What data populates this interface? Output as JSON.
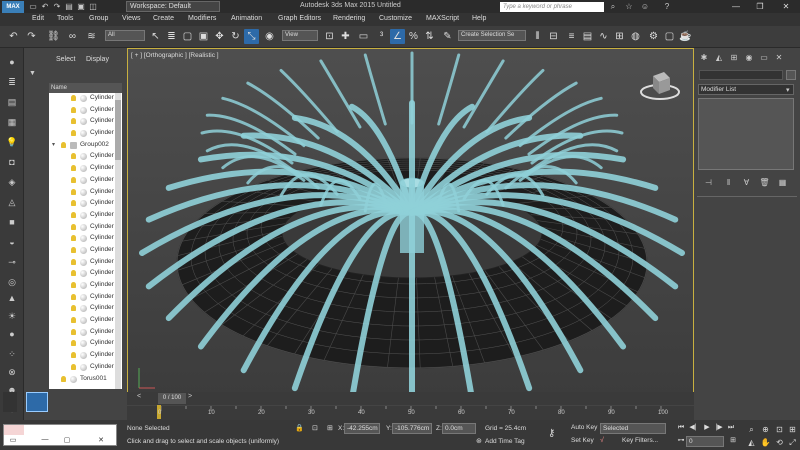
{
  "titlebar": {
    "app_icon": "MAX",
    "workspace": "Workspace: Default",
    "title": "Autodesk 3ds Max  2015      Untitled",
    "search_placeholder": "Type a keyword or phrase",
    "icons": [
      "binoculars-icon",
      "star-icon",
      "user-icon",
      "help-icon"
    ],
    "window_controls": [
      "—",
      "❐",
      "✕"
    ]
  },
  "menubar": {
    "items": [
      "Edit",
      "Tools",
      "Group",
      "Views",
      "Create",
      "Modifiers",
      "Animation",
      "Graph Editors",
      "Rendering",
      "Customize",
      "MAXScript",
      "Help"
    ]
  },
  "toolbar": {
    "filter_value": "All",
    "ref_coord_value": "View",
    "selection_set_value": "Create Selection Se"
  },
  "scene_explorer": {
    "tabs": [
      "Select",
      "Display"
    ],
    "column_header": "Name",
    "rows": [
      {
        "indent": 2,
        "type": "obj",
        "name": "Cylinder"
      },
      {
        "indent": 2,
        "type": "obj",
        "name": "Cylinder"
      },
      {
        "indent": 2,
        "type": "obj",
        "name": "Cylinder"
      },
      {
        "indent": 2,
        "type": "obj",
        "name": "Cylinder"
      },
      {
        "indent": 1,
        "type": "group",
        "name": "Group002"
      },
      {
        "indent": 2,
        "type": "obj",
        "name": "Cylinder"
      },
      {
        "indent": 2,
        "type": "obj",
        "name": "Cylinder"
      },
      {
        "indent": 2,
        "type": "obj",
        "name": "Cylinder"
      },
      {
        "indent": 2,
        "type": "obj",
        "name": "Cylinder"
      },
      {
        "indent": 2,
        "type": "obj",
        "name": "Cylinder"
      },
      {
        "indent": 2,
        "type": "obj",
        "name": "Cylinder"
      },
      {
        "indent": 2,
        "type": "obj",
        "name": "Cylinder"
      },
      {
        "indent": 2,
        "type": "obj",
        "name": "Cylinder"
      },
      {
        "indent": 2,
        "type": "obj",
        "name": "Cylinder"
      },
      {
        "indent": 2,
        "type": "obj",
        "name": "Cylinder"
      },
      {
        "indent": 2,
        "type": "obj",
        "name": "Cylinder"
      },
      {
        "indent": 2,
        "type": "obj",
        "name": "Cylinder"
      },
      {
        "indent": 2,
        "type": "obj",
        "name": "Cylinder"
      },
      {
        "indent": 2,
        "type": "obj",
        "name": "Cylinder"
      },
      {
        "indent": 2,
        "type": "obj",
        "name": "Cylinder"
      },
      {
        "indent": 2,
        "type": "obj",
        "name": "Cylinder"
      },
      {
        "indent": 2,
        "type": "obj",
        "name": "Cylinder"
      },
      {
        "indent": 2,
        "type": "obj",
        "name": "Cylinder"
      },
      {
        "indent": 2,
        "type": "obj",
        "name": "Cylinder"
      },
      {
        "indent": 1,
        "type": "obj",
        "name": "Torus001"
      }
    ]
  },
  "viewport": {
    "label": "[ + ] [Orthographic ] [Realistic ]"
  },
  "command_panel": {
    "modifier_list": "Modifier List"
  },
  "timeline": {
    "frame_label": "0 / 100",
    "ticks": [
      "0",
      "10",
      "20",
      "30",
      "40",
      "50",
      "60",
      "70",
      "80",
      "90",
      "100"
    ]
  },
  "status": {
    "selection": "None Selected",
    "hint": "Click and drag to select and scale objects (uniformly)",
    "x_label": "X:",
    "x_value": "-42.255cm",
    "y_label": "Y:",
    "y_value": "-105.776cm",
    "z_label": "Z:",
    "z_value": "0.0cm",
    "grid": "Grid = 25.4cm",
    "add_time_tag": "Add Time Tag",
    "auto_key": "Auto Key",
    "set_key": "Set Key",
    "selected_value": "Selected",
    "key_filters": "Key Filters...",
    "frame_value": "0"
  },
  "colors": {
    "accent": "#2d6aa8",
    "viewport_border": "#c8b040",
    "wire": "#8fd0d8"
  }
}
